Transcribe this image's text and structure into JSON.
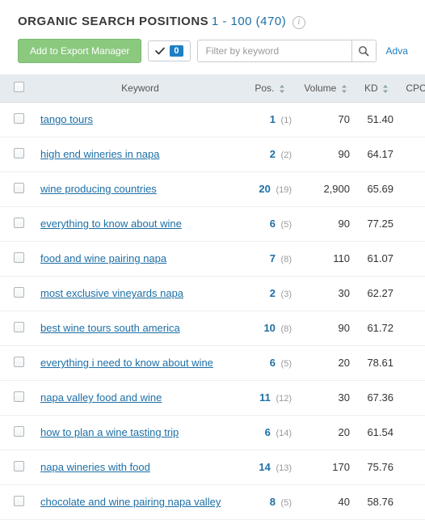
{
  "header": {
    "title": "ORGANIC SEARCH POSITIONS",
    "range": "1 - 100 (470)"
  },
  "toolbar": {
    "export_label": "Add to Export Manager",
    "checked_count": "0",
    "filter_placeholder": "Filter by keyword",
    "advanced_label": "Adva"
  },
  "columns": {
    "keyword": "Keyword",
    "pos": "Pos.",
    "volume": "Volume",
    "kd": "KD",
    "cpc": "CPC"
  },
  "rows": [
    {
      "keyword": "tango tours",
      "pos": "1",
      "prev": "(1)",
      "volume": "70",
      "kd": "51.40",
      "cpc": ""
    },
    {
      "keyword": "high end wineries in napa",
      "pos": "2",
      "prev": "(2)",
      "volume": "90",
      "kd": "64.17",
      "cpc": ""
    },
    {
      "keyword": "wine producing countries",
      "pos": "20",
      "prev": "(19)",
      "volume": "2,900",
      "kd": "65.69",
      "cpc": ""
    },
    {
      "keyword": "everything to know about wine",
      "pos": "6",
      "prev": "(5)",
      "volume": "90",
      "kd": "77.25",
      "cpc": ""
    },
    {
      "keyword": "food and wine pairing napa",
      "pos": "7",
      "prev": "(8)",
      "volume": "110",
      "kd": "61.07",
      "cpc": ""
    },
    {
      "keyword": "most exclusive vineyards napa",
      "pos": "2",
      "prev": "(3)",
      "volume": "30",
      "kd": "62.27",
      "cpc": ""
    },
    {
      "keyword": "best wine tours south america",
      "pos": "10",
      "prev": "(8)",
      "volume": "90",
      "kd": "61.72",
      "cpc": ""
    },
    {
      "keyword": "everything i need to know about wine",
      "pos": "6",
      "prev": "(5)",
      "volume": "20",
      "kd": "78.61",
      "cpc": ""
    },
    {
      "keyword": "napa valley food and wine",
      "pos": "11",
      "prev": "(12)",
      "volume": "30",
      "kd": "67.36",
      "cpc": ""
    },
    {
      "keyword": "how to plan a wine tasting trip",
      "pos": "6",
      "prev": "(14)",
      "volume": "20",
      "kd": "61.54",
      "cpc": ""
    },
    {
      "keyword": "napa wineries with food",
      "pos": "14",
      "prev": "(13)",
      "volume": "170",
      "kd": "75.76",
      "cpc": ""
    },
    {
      "keyword": "chocolate and wine pairing napa valley",
      "pos": "8",
      "prev": "(5)",
      "volume": "40",
      "kd": "58.76",
      "cpc": ""
    }
  ]
}
